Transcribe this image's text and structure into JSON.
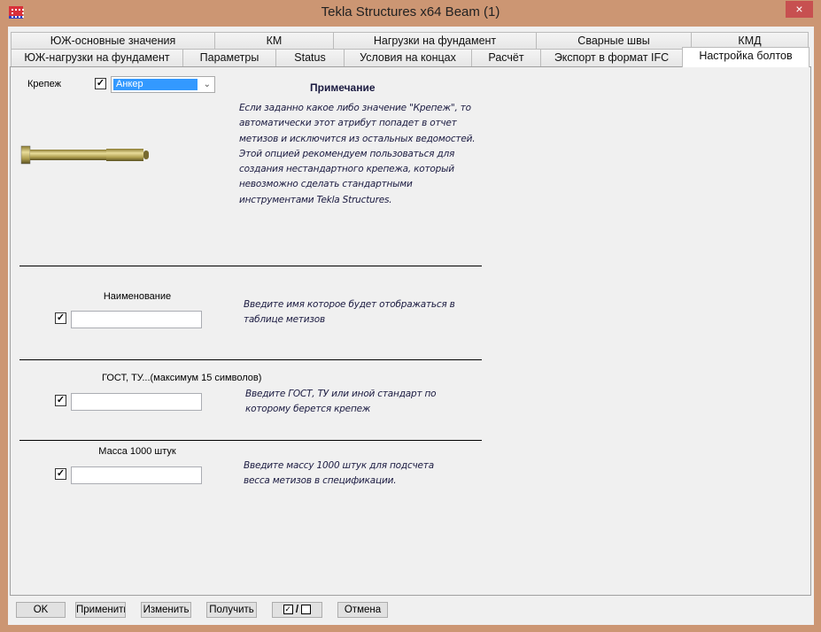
{
  "window": {
    "title": "Tekla Structures x64  Beam (1)",
    "close_icon": "×"
  },
  "tabs_row1": [
    "ЮЖ-основные значения",
    "КМ",
    "Нагрузки на фундамент",
    "Сварные швы",
    "КМД"
  ],
  "tabs_row2": [
    "ЮЖ-нагрузки на фундамент",
    "Параметры",
    "Status",
    "Условия на концах",
    "Расчёт",
    "Экспорт в формат IFC",
    "Настройка болтов"
  ],
  "fastener": {
    "label": "Крепеж",
    "checked": true,
    "value": "Анкер"
  },
  "note": {
    "title": "Примечание",
    "lines": [
      "Если заданно какое либо значение \"Крепеж\", то",
      "автоматически этот атрибут попадет в отчет",
      "метизов и исключится из остальных ведомостей.",
      "Этой опцией рекомендуем пользоваться для",
      "создания нестандартного крепежа, который",
      "невозможно сделать стандартными",
      "инструментами Tekla Structures."
    ]
  },
  "fields": [
    {
      "label": "Наименование",
      "value": "",
      "checked": true,
      "hint": [
        "Введите имя которое будет отображаться в",
        "таблице метизов"
      ]
    },
    {
      "label": "ГОСТ, ТУ...(максимум 15 символов)",
      "value": "",
      "checked": true,
      "hint": [
        "Введите ГОСТ, ТУ или иной стандарт по",
        "которому берется крепеж"
      ]
    },
    {
      "label": "Масса 1000 штук",
      "value": "",
      "checked": true,
      "hint": [
        "Введите массу 1000 штук для подсчета",
        "весса метизов в спецификации."
      ]
    }
  ],
  "buttons": {
    "ok": "OK",
    "apply": "Применить",
    "modify": "Изменить",
    "get": "Получить",
    "toggle_on": "✓",
    "toggle_sep": "/",
    "cancel": "Отмена"
  }
}
